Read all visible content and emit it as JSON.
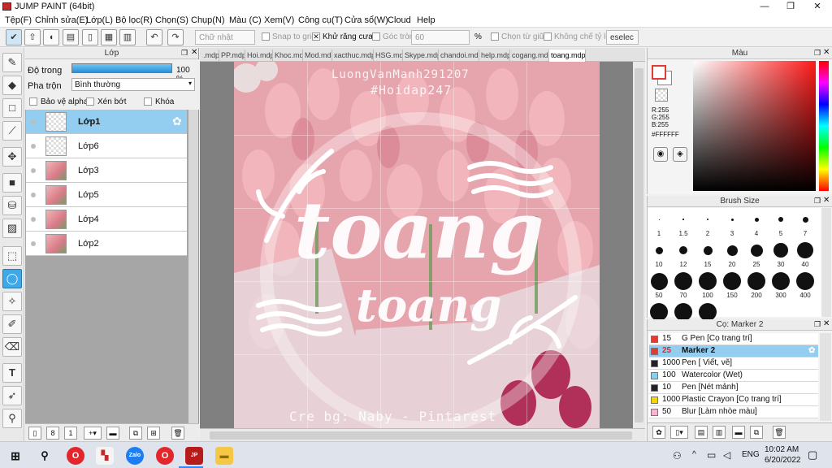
{
  "window": {
    "title": "JUMP PAINT (64bit)"
  },
  "menu": [
    "Tệp(F)",
    "Chỉnh sửa(E)",
    "Lớp(L)",
    "Bộ lọc(R)",
    "Chọn(S)",
    "Chụp(N)",
    "Màu (C)",
    "Xem(V)",
    "Công cụ(T)",
    "Cửa sổ(W)",
    "Cloud",
    "Help"
  ],
  "toolbar": {
    "shape_select": "Chữ nhật",
    "snap_grid": "Snap to grid",
    "antialias": "Khử răng cưa",
    "corner": "Góc tròn",
    "corner_value": "60",
    "percent": "%",
    "select_center": "Chọn từ giữa",
    "fixed_ratio": "Không chế tỷ lệ",
    "deselect": "eselec"
  },
  "layers_panel": {
    "title": "Lớp",
    "opacity_label": "Độ trong",
    "opacity_value": "100 %",
    "opacity_fraction": 1.0,
    "blend_label": "Pha trộn",
    "blend_value": "Bình thường",
    "protect_alpha": "Bảo vệ alpha",
    "clipping": "Xén bớt",
    "lock": "Khóa",
    "layers": [
      {
        "name": "Lớp1",
        "selected": true,
        "thumb": "checker"
      },
      {
        "name": "Lớp6",
        "selected": false,
        "thumb": "checker"
      },
      {
        "name": "Lớp3",
        "selected": false,
        "thumb": "pink"
      },
      {
        "name": "Lớp5",
        "selected": false,
        "thumb": "pink"
      },
      {
        "name": "Lớp4",
        "selected": false,
        "thumb": "pink"
      },
      {
        "name": "Lớp2",
        "selected": false,
        "thumb": "pink"
      }
    ]
  },
  "tabs": [
    ".mdp",
    "PP.mdp",
    "Hoi.mdp",
    "Khoc.mdp",
    "Mod.mdp",
    "xacthuc.mdp",
    "HSG.mdp",
    "Skype.mdp",
    "chandoi.mdp",
    "help.mdp",
    "cogang.mdp",
    "toang.mdp"
  ],
  "canvas": {
    "watermark_name": "LuongVanManh291207",
    "watermark_tag": "#Hoidap247",
    "big_text_1": "toang",
    "big_text_2": "toang",
    "credit": "Cre bg: Naby - Pintarest"
  },
  "color_panel": {
    "title": "Màu",
    "r": "R:255",
    "g": "G:255",
    "b": "B:255",
    "hex": "#FFFFFF",
    "primary_color": "#ffffff",
    "accent": "#e53935"
  },
  "brush_panel": {
    "title": "Brush Size",
    "sizes": [
      "1",
      "1.5",
      "2",
      "3",
      "4",
      "5",
      "7",
      "10",
      "12",
      "15",
      "20",
      "25",
      "30",
      "40",
      "50",
      "70",
      "100",
      "150",
      "200",
      "300",
      "400"
    ]
  },
  "pen_panel": {
    "title": "Cọ: Marker 2",
    "pens": [
      {
        "size": "15",
        "name": "G Pen [Cọ trang trí]",
        "color": "#e53935",
        "selected": false
      },
      {
        "size": "25",
        "name": "Marker 2",
        "color": "#e53935",
        "selected": true
      },
      {
        "size": "1000",
        "name": "Pen [ Viết, vẽ]",
        "color": "#222222",
        "selected": false
      },
      {
        "size": "100",
        "name": "Watercolor (Wet)",
        "color": "#7fd3f0",
        "selected": false
      },
      {
        "size": "10",
        "name": "Pen [Nét mảnh]",
        "color": "#222222",
        "selected": false
      },
      {
        "size": "1000",
        "name": "Plastic Crayon [Cọ trang trí]",
        "color": "#f2d600",
        "selected": false
      },
      {
        "size": "50",
        "name": "Blur [Làm nhòe màu]",
        "color": "#f7b6d2",
        "selected": false
      }
    ]
  },
  "taskbar": {
    "lang": "ENG",
    "time": "10:02 AM",
    "date": "6/20/2022"
  }
}
